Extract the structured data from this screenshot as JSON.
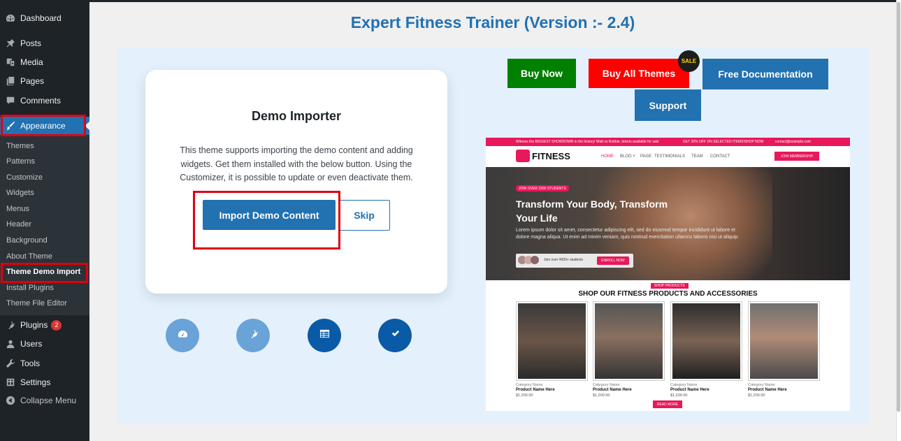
{
  "sidebar": {
    "items": [
      {
        "label": "Dashboard",
        "icon": "dashboard-icon"
      },
      {
        "label": "Posts",
        "icon": "pin-icon"
      },
      {
        "label": "Media",
        "icon": "media-icon"
      },
      {
        "label": "Pages",
        "icon": "pages-icon"
      },
      {
        "label": "Comments",
        "icon": "comment-icon"
      },
      {
        "label": "Appearance",
        "icon": "brush-icon"
      },
      {
        "label": "Plugins",
        "icon": "plugin-icon",
        "badge": "2"
      },
      {
        "label": "Users",
        "icon": "user-icon"
      },
      {
        "label": "Tools",
        "icon": "wrench-icon"
      },
      {
        "label": "Settings",
        "icon": "settings-icon"
      },
      {
        "label": "Collapse Menu",
        "icon": "collapse-icon"
      }
    ],
    "submenu": [
      "Themes",
      "Patterns",
      "Customize",
      "Widgets",
      "Menus",
      "Header",
      "Background",
      "About Theme",
      "Theme Demo Import",
      "Install Plugins",
      "Theme File Editor"
    ],
    "current_submenu": "Theme Demo Import"
  },
  "page": {
    "title": "Expert Fitness Trainer (Version :- 2.4)"
  },
  "importer": {
    "title": "Demo Importer",
    "description": "This theme supports importing the demo content and adding widgets. Get them installed with the below button. Using the Customizer, it is possible to update or even deactivate them.",
    "import_label": "Import Demo Content",
    "skip_label": "Skip"
  },
  "steps": [
    {
      "icon": "gauge-icon",
      "color": "#6aa3d8"
    },
    {
      "icon": "plug-icon",
      "color": "#6aa3d8"
    },
    {
      "icon": "table-icon",
      "color": "#0a5aa8"
    },
    {
      "icon": "check-icon",
      "color": "#0a5aa8"
    }
  ],
  "actions": {
    "buy_now": "Buy Now",
    "buy_all": "Buy All Themes",
    "sale": "SALE",
    "docs": "Free Documentation",
    "support": "Support"
  },
  "colors": {
    "primary": "#2271b1",
    "buy_now": "#008000",
    "buy_all": "#ff0000",
    "accent_pink": "#e8185a"
  },
  "preview": {
    "topbar_left": "Witness the BIGGEST SHOWDOWN in the history! Watt vs Robbie, tickets available for sale",
    "topbar_mid": "GET 20% OFF ON SELECTED ITEMS!SHOP NOW",
    "topbar_right": "contact@example.com",
    "logo": "FITNESS",
    "nav": [
      "HOME",
      "BLOG ˅",
      "PAGE",
      "TESTIMONIALS",
      "TEAM",
      "CONTACT"
    ],
    "join": "JOIN MEMBERSHIP",
    "hero_badge": "JOIN OVER 2300 STUDENTS",
    "hero_title": "Transform Your Body, Transform Your Life",
    "hero_text": "Lorem ipsum dolor sit amet, consectetur adipiscing elit, sed do eiusmod tempor incididunt ut labore et dolore magna aliqua. Ut enim ad minim veniam, quis nostrud exercitation ullamco laboris nisi ut aliquip.",
    "hero_strip": "Join over 4000+ students",
    "hero_cta": "ENROLL NOW",
    "shop_tag": "SHOP PRODUCTS",
    "shop_title": "SHOP OUR FITNESS PRODUCTS AND ACCESSORIES",
    "products": [
      {
        "category": "Category Name",
        "name": "Product Name Here",
        "price": "$1,200.00"
      },
      {
        "category": "Category Name",
        "name": "Product Name Here",
        "price": "$1,200.00"
      },
      {
        "category": "Category Name",
        "name": "Product Name Here",
        "price": "$1,200.00"
      },
      {
        "category": "Category Name",
        "name": "Product Name Here",
        "price": "$1,200.00"
      }
    ],
    "read_more": "READ MORE"
  }
}
